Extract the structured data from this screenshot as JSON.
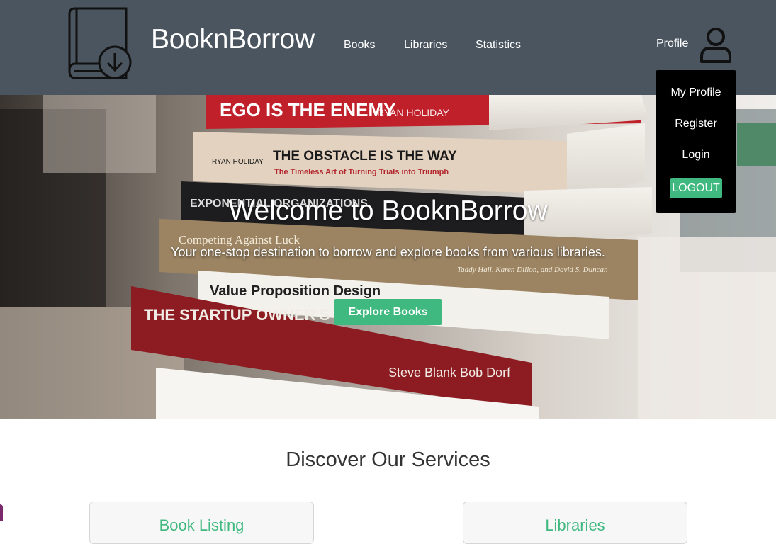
{
  "header": {
    "brand": "BooknBorrow",
    "logo_icon": "book-download-icon",
    "nav": {
      "books": "Books",
      "libraries": "Libraries",
      "statistics": "Statistics"
    },
    "profile_label": "Profile",
    "profile_icon": "user-icon"
  },
  "dropdown": {
    "my_profile": "My Profile",
    "register": "Register",
    "login": "Login",
    "logout": "LOGOUT"
  },
  "hero": {
    "title": "Welcome to BooknBorrow",
    "subtitle": "Your one-stop destination to borrow and explore books from various libraries.",
    "button": "Explore Books",
    "books": {
      "b1_title": "EGO IS THE ENEMY",
      "b1_author": "RYAN HOLIDAY",
      "b2_title": "THE OBSTACLE IS THE WAY",
      "b2_sub": "The Timeless Art of Turning Trials into Triumph",
      "b2_author": "RYAN HOLIDAY",
      "b3_title": "EXPONENTIAL ORGANIZATIONS",
      "b4_title": "Competing Against Luck",
      "b4_author": "Taddy Hall, Karen Dillon, and David S. Duncan",
      "b5_title": "Value Proposition Design",
      "b6_title": "THE STARTUP OWNER'S MANUAL",
      "b6_author": "Steve Blank Bob Dorf"
    }
  },
  "services": {
    "title": "Discover Our Services",
    "cards": [
      {
        "title": "Book Listing"
      },
      {
        "title": "Libraries"
      }
    ]
  },
  "colors": {
    "header_bg": "#4a5560",
    "accent": "#3fb97f",
    "dropdown_bg": "#000000"
  }
}
